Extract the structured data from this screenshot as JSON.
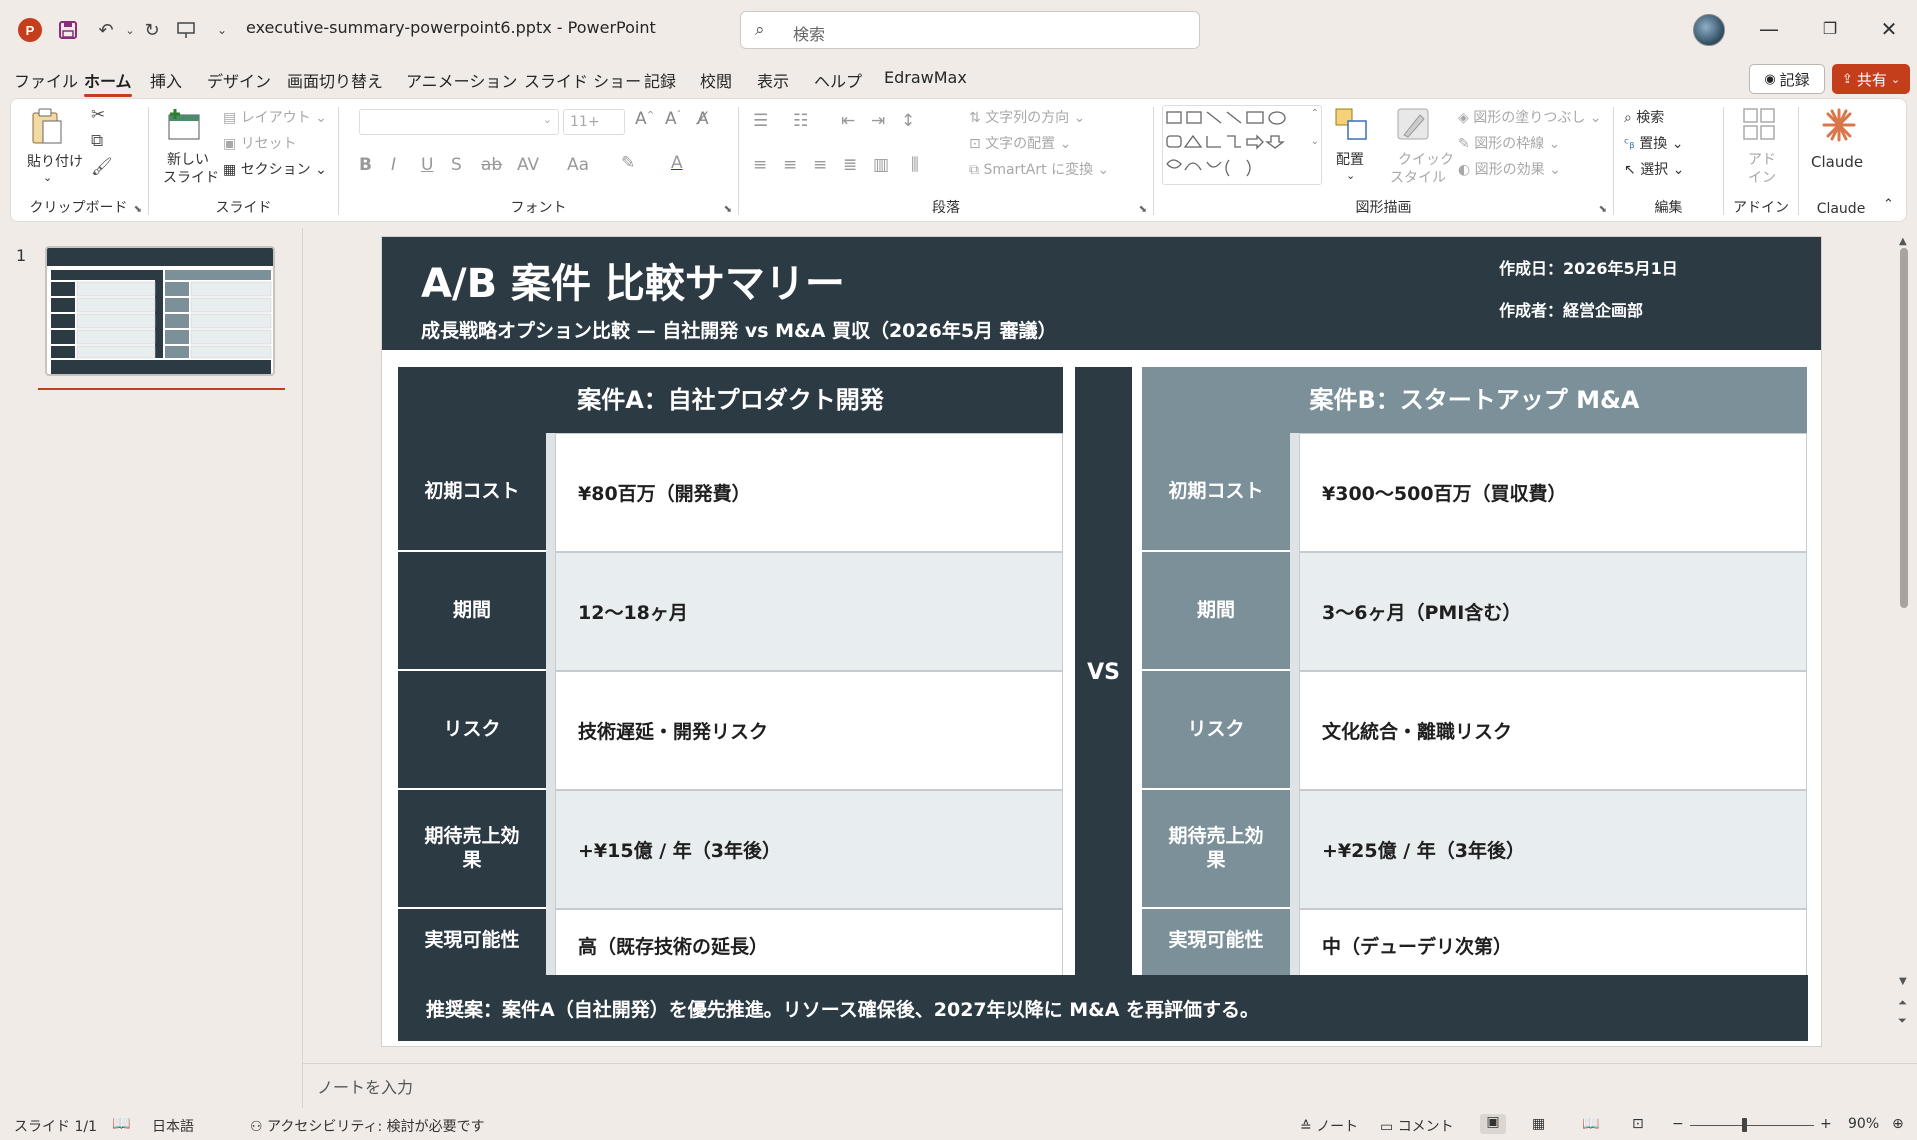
{
  "app": {
    "doc_title": "executive-summary-powerpoint6.pptx  -  PowerPoint",
    "search_placeholder": "検索"
  },
  "menu": {
    "items": [
      "ファイル",
      "ホーム",
      "挿入",
      "デザイン",
      "画面切り替え",
      "アニメーション",
      "スライド ショー",
      "記録",
      "校閲",
      "表示",
      "ヘルプ",
      "EdrawMax"
    ],
    "active": "ホーム",
    "record_label": "記録",
    "share_label": "共有"
  },
  "ribbon": {
    "clipboard": {
      "label": "クリップボード",
      "paste": "貼り付け"
    },
    "slides": {
      "label": "スライド",
      "new_slide_1": "新しい",
      "new_slide_2": "スライド",
      "layout": "レイアウト",
      "reset": "リセット",
      "section": "セクション"
    },
    "font": {
      "label": "フォント",
      "size": "11+"
    },
    "paragraph": {
      "label": "段落",
      "text_direction": "文字列の方向",
      "align_text": "文字の配置",
      "smartart": "SmartArt に変換"
    },
    "drawing": {
      "label": "図形描画",
      "arrange": "配置",
      "quick_style_1": "クイック",
      "quick_style_2": "スタイル",
      "fill": "図形の塗りつぶし",
      "outline": "図形の枠線",
      "effects": "図形の効果"
    },
    "editing": {
      "label": "編集",
      "find": "検索",
      "replace": "置換",
      "select": "選択"
    },
    "addins": {
      "label": "アドイン",
      "btn_1": "アド",
      "btn_2": "イン"
    },
    "claude": {
      "label": "Claude",
      "btn": "Claude"
    }
  },
  "thumbnail": {
    "number": "1"
  },
  "slide": {
    "title": "A/B 案件 比較サマリー",
    "subtitle": "成長戦略オプション比較 — 自社開発 vs M&A 買収（2026年5月 審議）",
    "created_date": "作成日：2026年5月1日",
    "author": "作成者：経営企画部",
    "vs_label": "VS",
    "colors": {
      "header_dark": "#2c3a43",
      "col_b": "#7b9099",
      "shade": "#e8edf0"
    },
    "column_a": {
      "heading": "案件A：自社プロダクト開発",
      "rows": [
        {
          "label": "初期コスト",
          "value": "¥80百万（開発費）"
        },
        {
          "label": "期間",
          "value": "12〜18ヶ月"
        },
        {
          "label": "リスク",
          "value": "技術遅延・開発リスク"
        },
        {
          "label": "期待売上効果",
          "value": "+¥15億 / 年（3年後）"
        },
        {
          "label": "実現可能性",
          "value": "高（既存技術の延長）"
        }
      ]
    },
    "column_b": {
      "heading": "案件B：スタートアップ M&A",
      "rows": [
        {
          "label": "初期コスト",
          "value": "¥300〜500百万（買収費）"
        },
        {
          "label": "期間",
          "value": "3〜6ヶ月（PMI含む）"
        },
        {
          "label": "リスク",
          "value": "文化統合・離職リスク"
        },
        {
          "label": "期待売上効果",
          "value": "+¥25億 / 年（3年後）"
        },
        {
          "label": "実現可能性",
          "value": "中（デューデリ次第）"
        }
      ]
    },
    "recommendation": "推奨案：案件A（自社開発）を優先推進。リソース確保後、2027年以降に M&A を再評価する。"
  },
  "notes_placeholder": "ノートを入力",
  "status": {
    "slide_count": "スライド 1/1",
    "language": "日本語",
    "accessibility": "アクセシビリティ: 検討が必要です",
    "notes": "ノート",
    "comments": "コメント",
    "zoom": "90%"
  }
}
